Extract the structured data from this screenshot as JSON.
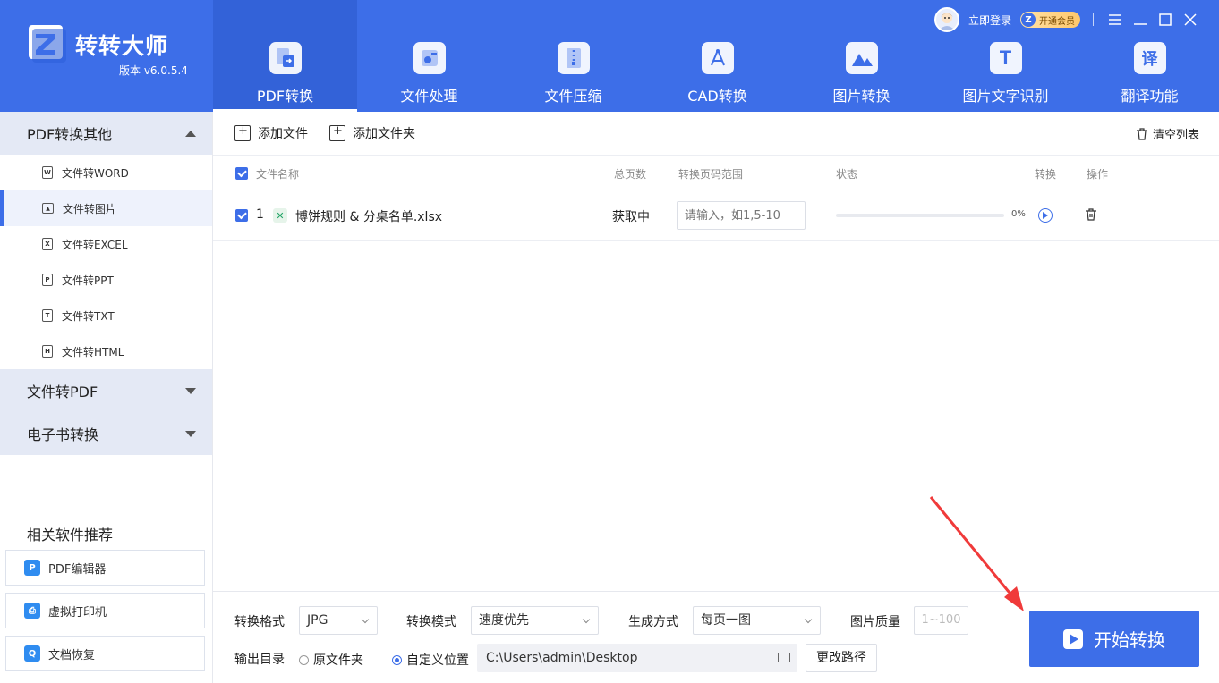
{
  "app": {
    "name": "转转大师",
    "version": "版本 v6.0.5.4",
    "login": "立即登录",
    "vip": "开通会员",
    "vip_badge": "Z"
  },
  "nav": [
    {
      "label": "PDF转换",
      "icon": "pdf-convert-icon",
      "active": true
    },
    {
      "label": "文件处理",
      "icon": "file-process-icon"
    },
    {
      "label": "文件压缩",
      "icon": "file-compress-icon"
    },
    {
      "label": "CAD转换",
      "icon": "cad-icon"
    },
    {
      "label": "图片转换",
      "icon": "image-convert-icon"
    },
    {
      "label": "图片文字识别",
      "icon": "ocr-icon",
      "glyph": "T"
    },
    {
      "label": "翻译功能",
      "icon": "translate-icon",
      "glyph": "译"
    }
  ],
  "sidebar": {
    "groups": [
      {
        "label": "PDF转换其他",
        "expanded": true,
        "items": [
          {
            "label": "文件转WORD",
            "glyph": "W"
          },
          {
            "label": "文件转图片",
            "glyph": "▲",
            "active": true
          },
          {
            "label": "文件转EXCEL",
            "glyph": "X"
          },
          {
            "label": "文件转PPT",
            "glyph": "P"
          },
          {
            "label": "文件转TXT",
            "glyph": "T"
          },
          {
            "label": "文件转HTML",
            "glyph": "H"
          }
        ]
      },
      {
        "label": "文件转PDF",
        "expanded": false
      },
      {
        "label": "电子书转换",
        "expanded": false
      }
    ],
    "recommend_title": "相关软件推荐",
    "recommend": [
      {
        "label": "PDF编辑器",
        "glyph": "P"
      },
      {
        "label": "虚拟打印机",
        "glyph": "⎙"
      },
      {
        "label": "文档恢复",
        "glyph": "Q"
      }
    ]
  },
  "toolbar": {
    "add_file": "添加文件",
    "add_folder": "添加文件夹",
    "clear": "清空列表"
  },
  "table": {
    "headers": {
      "name": "文件名称",
      "pages": "总页数",
      "range": "转换页码范围",
      "status": "状态",
      "convert": "转换",
      "action": "操作"
    },
    "rows": [
      {
        "index": "1",
        "name": "博饼规则 & 分桌名单.xlsx",
        "pages": "获取中",
        "range_placeholder": "请输入，如1,5-10",
        "progress_value": 0,
        "progress_text": "0%"
      }
    ]
  },
  "settings": {
    "format_label": "转换格式",
    "format_value": "JPG",
    "mode_label": "转换模式",
    "mode_value": "速度优先",
    "gen_label": "生成方式",
    "gen_value": "每页一图",
    "quality_label": "图片质量",
    "quality_placeholder": "1~100",
    "output_label": "输出目录",
    "opt_original": "原文件夹",
    "opt_custom": "自定义位置",
    "selected_output": "custom",
    "path": "C:\\Users\\admin\\Desktop",
    "change_path": "更改路径",
    "start": "开始转换"
  },
  "colors": {
    "accent": "#3d6ee8",
    "annotation_arrow": "#f03a3a"
  }
}
